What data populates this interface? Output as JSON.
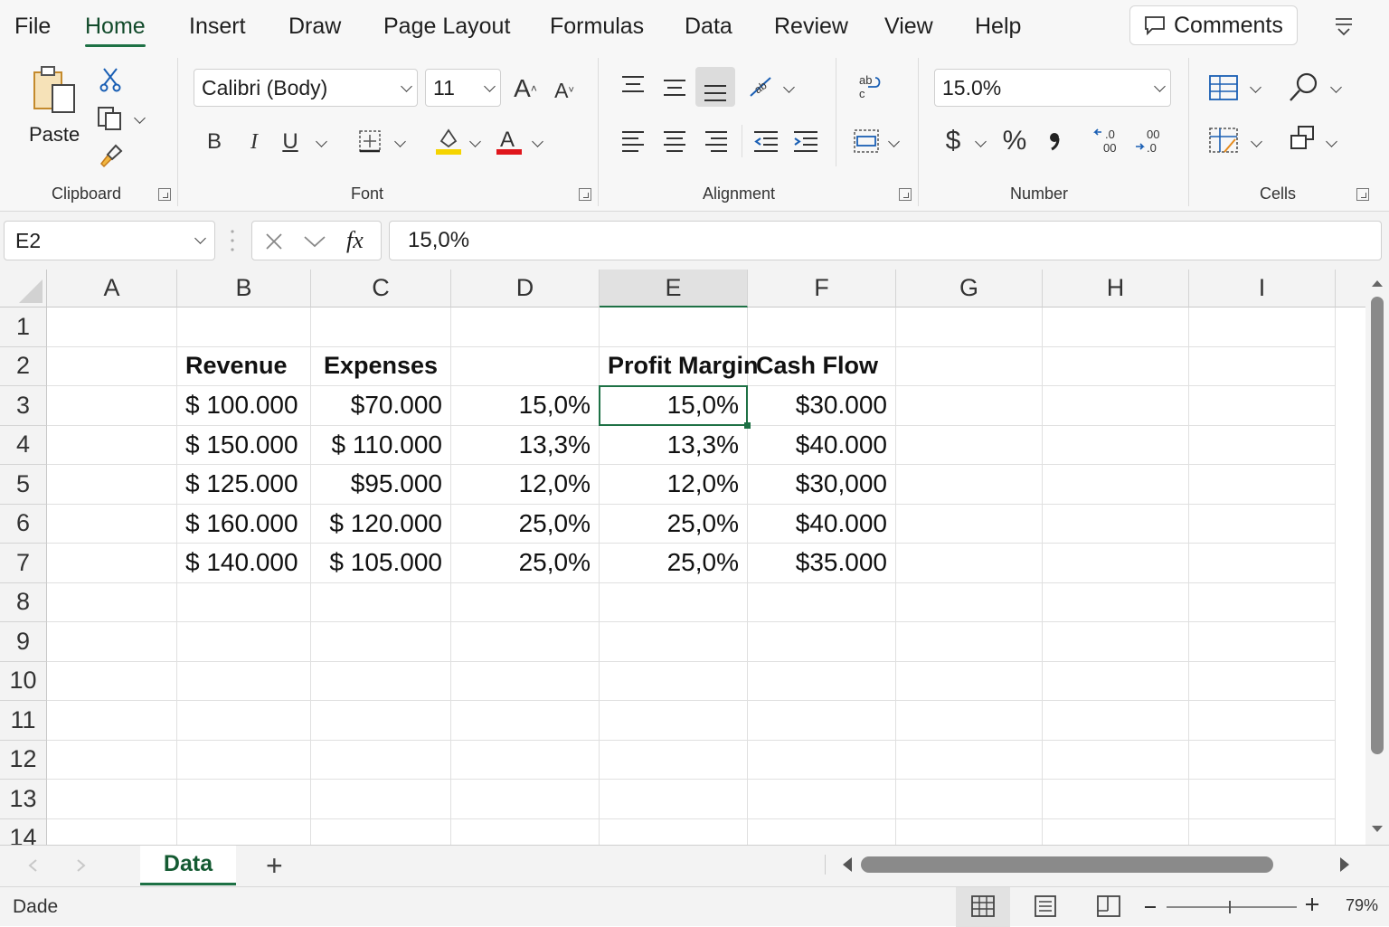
{
  "menu": {
    "tabs": [
      "File",
      "Home",
      "Insert",
      "Draw",
      "Page Layout",
      "Formulas",
      "Data",
      "Review",
      "View",
      "Help"
    ],
    "active": "Home",
    "comments_label": "Comments"
  },
  "ribbon": {
    "clipboard": {
      "paste_label": "Paste",
      "group_label": "Clipboard"
    },
    "font": {
      "family": "Calibri (Body)",
      "size": "11",
      "group_label": "Font",
      "fill_color": "#f5d400",
      "font_color": "#e0161c"
    },
    "alignment": {
      "group_label": "Alignment"
    },
    "number": {
      "format": "15.0%",
      "currency_symbol": "$",
      "percent_symbol": "%",
      "group_label": "Number"
    },
    "cells": {
      "group_label": "Cells"
    }
  },
  "formula_bar": {
    "name_box": "E2",
    "formula": "15,0%"
  },
  "sheet": {
    "columns": [
      "A",
      "B",
      "C",
      "D",
      "E",
      "F",
      "G",
      "H",
      "I"
    ],
    "selected_column": "E",
    "rows": [
      "1",
      "2",
      "3",
      "4",
      "5",
      "6",
      "7",
      "8",
      "9",
      "10",
      "11",
      "12",
      "13",
      "14"
    ],
    "headers": {
      "B": "Revenue",
      "C": "Expenses",
      "E": "Profit Margin",
      "F": "Cash Flow"
    },
    "data": [
      {
        "B": "$ 100.000",
        "C": "$70.000",
        "D": "15,0%",
        "E": "15,0%",
        "F": "$30.000"
      },
      {
        "B": "$ 150.000",
        "C": "$ 110.000",
        "D": "13,3%",
        "E": "13,3%",
        "F": "$40.000"
      },
      {
        "B": "$ 125.000",
        "C": "$95.000",
        "D": "12,0%",
        "E": "12,0%",
        "F": "$30,000"
      },
      {
        "B": "$ 160.000",
        "C": "$ 120.000",
        "D": "25,0%",
        "E": "25,0%",
        "F": "$40.000"
      },
      {
        "B": "$ 140.000",
        "C": "$ 105.000",
        "D": "25,0%",
        "E": "25,0%",
        "F": "$35.000"
      }
    ]
  },
  "sheet_tabs": {
    "active": "Data",
    "add_label": "+"
  },
  "status": {
    "text": "Dade",
    "zoom": "79%",
    "zoom_value": 0.48
  },
  "colors": {
    "accent": "#1e7145"
  }
}
